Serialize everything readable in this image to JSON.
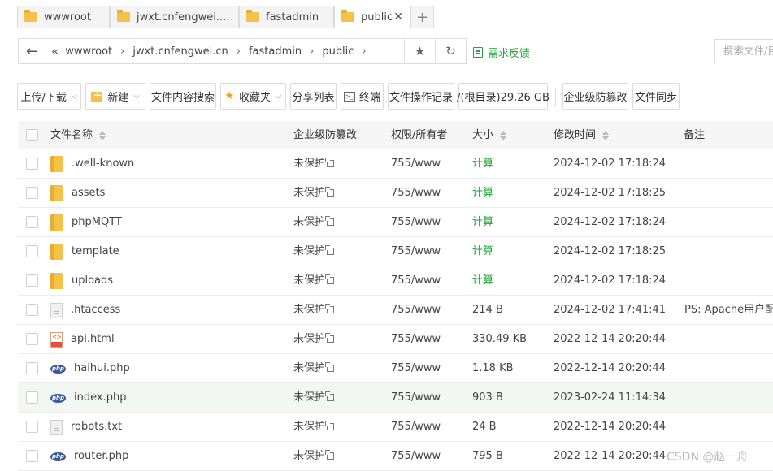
{
  "tabs": [
    {
      "label": "wwwroot",
      "active": false
    },
    {
      "label": "jwxt.cnfengwei....",
      "active": false
    },
    {
      "label": "fastadmin",
      "active": false
    },
    {
      "label": "public",
      "active": true
    }
  ],
  "address": {
    "crumbs": [
      "wwwroot",
      "jwxt.cnfengwei.cn",
      "fastadmin",
      "public"
    ],
    "feedback": "需求反馈",
    "search_placeholder": "搜索文件/目录"
  },
  "toolbar": {
    "upload": "上传/下载",
    "new": "新建",
    "content_search": "文件内容搜索",
    "favorites": "收藏夹",
    "share_list": "分享列表",
    "terminal": "终端",
    "op_log": "文件操作记录",
    "root_usage": "/(根目录)29.26 GB",
    "tamper": "企业级防篡改",
    "sync": "文件同步"
  },
  "table": {
    "headers": {
      "name": "文件名称",
      "tamper": "企业级防篡改",
      "perm": "权限/所有者",
      "size": "大小",
      "mtime": "修改时间",
      "note": "备注"
    },
    "rows": [
      {
        "name": ".well-known",
        "type": "folder",
        "tamper": "未保护",
        "perm": "755/www",
        "size": "计算",
        "mtime": "2024-12-02 17:18:24",
        "note": ""
      },
      {
        "name": "assets",
        "type": "folder",
        "tamper": "未保护",
        "perm": "755/www",
        "size": "计算",
        "mtime": "2024-12-02 17:18:25",
        "note": ""
      },
      {
        "name": "phpMQTT",
        "type": "folder",
        "tamper": "未保护",
        "perm": "755/www",
        "size": "计算",
        "mtime": "2024-12-02 17:18:24",
        "note": ""
      },
      {
        "name": "template",
        "type": "folder",
        "tamper": "未保护",
        "perm": "755/www",
        "size": "计算",
        "mtime": "2024-12-02 17:18:25",
        "note": ""
      },
      {
        "name": "uploads",
        "type": "folder",
        "tamper": "未保护",
        "perm": "755/www",
        "size": "计算",
        "mtime": "2024-12-02 17:18:24",
        "note": ""
      },
      {
        "name": ".htaccess",
        "type": "doc",
        "tamper": "未保护",
        "perm": "755/www",
        "size": "214 B",
        "mtime": "2024-12-02 17:41:41",
        "note": "PS: Apache用户配置"
      },
      {
        "name": "api.html",
        "type": "html",
        "tamper": "未保护",
        "perm": "755/www",
        "size": "330.49 KB",
        "mtime": "2022-12-14 20:20:44",
        "note": ""
      },
      {
        "name": "haihui.php",
        "type": "php",
        "tamper": "未保护",
        "perm": "755/www",
        "size": "1.18 KB",
        "mtime": "2022-12-14 20:20:44",
        "note": ""
      },
      {
        "name": "index.php",
        "type": "php",
        "tamper": "未保护",
        "perm": "755/www",
        "size": "903 B",
        "mtime": "2023-02-24 11:14:34",
        "note": "",
        "highlight": true
      },
      {
        "name": "robots.txt",
        "type": "doc",
        "tamper": "未保护",
        "perm": "755/www",
        "size": "24 B",
        "mtime": "2022-12-14 20:20:44",
        "note": ""
      },
      {
        "name": "router.php",
        "type": "php",
        "tamper": "未保护",
        "perm": "755/www",
        "size": "795 B",
        "mtime": "2022-12-14 20:20:44",
        "note": ""
      }
    ]
  },
  "php_icon_text": "php",
  "watermark": "CSDN @赵一舟",
  "colors": {
    "accent": "#20a53a",
    "folder": "#f4c24b",
    "php": "#3b5998"
  }
}
